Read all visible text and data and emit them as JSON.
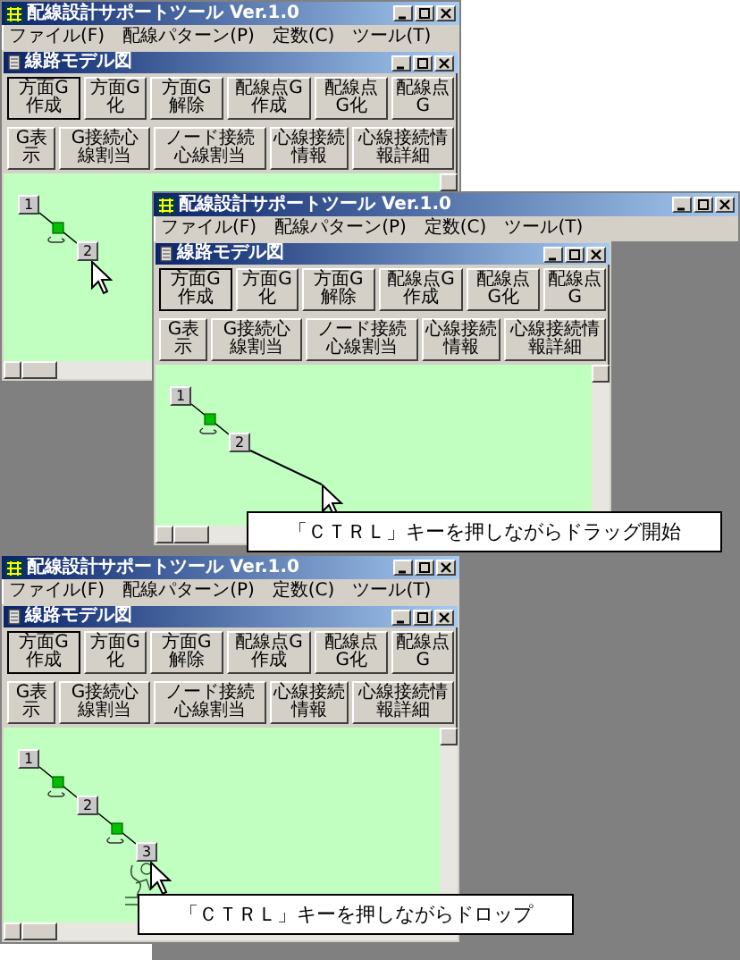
{
  "screens": [
    {
      "app_title": "配線設計サポートツール Ver.1.0",
      "menu": [
        "ファイル(F)",
        "配線パターン(P)",
        "定数(C)",
        "ツール(T)"
      ],
      "child_title": "線路モデル図",
      "toolbar_rows": [
        [
          {
            "label": "方面G作成",
            "focused": true
          },
          {
            "label": "方面G化",
            "focused": false
          },
          {
            "label": "方面G解除",
            "focused": false
          },
          {
            "label": "配線点G作成",
            "focused": false
          },
          {
            "label": "配線点G化",
            "focused": false
          },
          {
            "label": "配線点G",
            "focused": false
          }
        ],
        [
          {
            "label": "G表示",
            "focused": false
          },
          {
            "label": "G接続心線割当",
            "focused": false
          },
          {
            "label": "ノード接続心線割当",
            "focused": false
          },
          {
            "label": "心線接続情報",
            "focused": false
          },
          {
            "label": "心線接続情報詳細",
            "focused": false
          }
        ]
      ],
      "nodes": [
        {
          "label": "1"
        },
        {
          "label": "2"
        }
      ],
      "drag_line": false,
      "drop_marks": false
    },
    {
      "app_title": "配線設計サポートツール Ver.1.0",
      "menu": [
        "ファイル(F)",
        "配線パターン(P)",
        "定数(C)",
        "ツール(T)"
      ],
      "child_title": "線路モデル図",
      "toolbar_rows": [
        [
          {
            "label": "方面G作成",
            "focused": true
          },
          {
            "label": "方面G化",
            "focused": false
          },
          {
            "label": "方面G解除",
            "focused": false
          },
          {
            "label": "配線点G作成",
            "focused": false
          },
          {
            "label": "配線点G化",
            "focused": false
          },
          {
            "label": "配線点G",
            "focused": false
          }
        ],
        [
          {
            "label": "G表示",
            "focused": false
          },
          {
            "label": "G接続心線割当",
            "focused": false
          },
          {
            "label": "ノード接続心線割当",
            "focused": false
          },
          {
            "label": "心線接続情報",
            "focused": false
          },
          {
            "label": "心線接続情報詳細",
            "focused": false
          }
        ]
      ],
      "nodes": [
        {
          "label": "1"
        },
        {
          "label": "2"
        }
      ],
      "drag_line": true,
      "drop_marks": false
    },
    {
      "app_title": "配線設計サポートツール Ver.1.0",
      "menu": [
        "ファイル(F)",
        "配線パターン(P)",
        "定数(C)",
        "ツール(T)"
      ],
      "child_title": "線路モデル図",
      "toolbar_rows": [
        [
          {
            "label": "方面G作成",
            "focused": true
          },
          {
            "label": "方面G化",
            "focused": false
          },
          {
            "label": "方面G解除",
            "focused": false
          },
          {
            "label": "配線点G作成",
            "focused": false
          },
          {
            "label": "配線点G化",
            "focused": false
          },
          {
            "label": "配線点G",
            "focused": false
          }
        ],
        [
          {
            "label": "G表示",
            "focused": false
          },
          {
            "label": "G接続心線割当",
            "focused": false
          },
          {
            "label": "ノード接続心線割当",
            "focused": false
          },
          {
            "label": "心線接続情報",
            "focused": false
          },
          {
            "label": "心線接続情報詳細",
            "focused": false
          }
        ]
      ],
      "nodes": [
        {
          "label": "1"
        },
        {
          "label": "2"
        },
        {
          "label": "3"
        }
      ],
      "drag_line": false,
      "drop_marks": true
    }
  ],
  "captions": [
    {
      "text": "「ＣＴＲＬ」キーを押しながらドラッグ開始"
    },
    {
      "text": "「ＣＴＲＬ」キーを押しながらドロップ"
    }
  ]
}
